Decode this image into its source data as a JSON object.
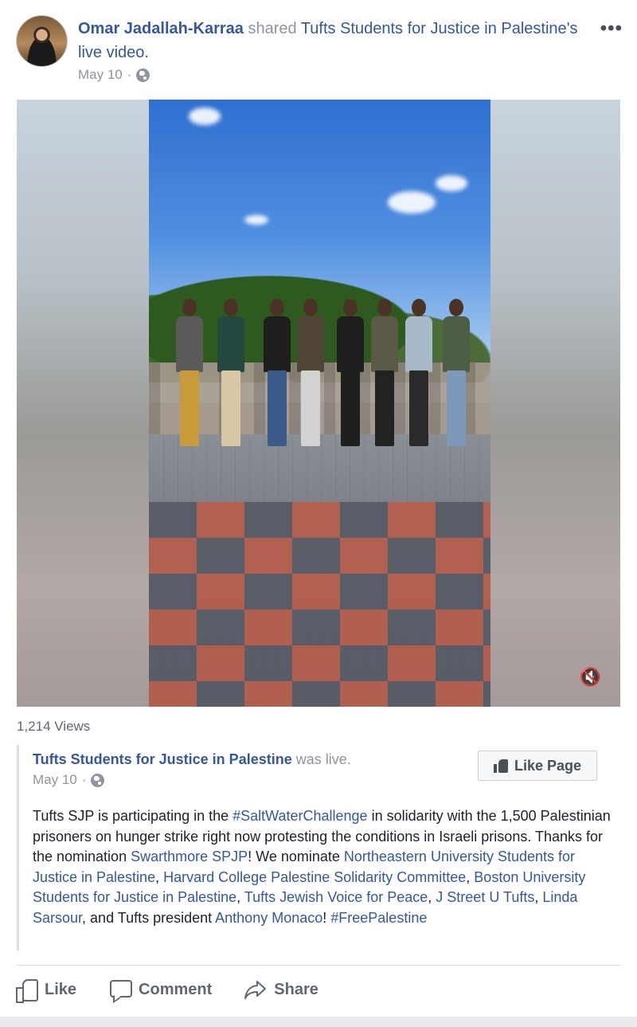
{
  "header": {
    "author": "Omar Jadallah-Karraa",
    "action_word": "shared",
    "shared_page": "Tufts Students for Justice in Palestine",
    "shared_suffix": "'s",
    "shared_object": "live video.",
    "date": "May 10",
    "separator": "·"
  },
  "more_label": "•••",
  "video": {
    "mute_icon": "🔇",
    "views": "1,214 Views"
  },
  "shared_post": {
    "page_name": "Tufts Students for Justice in Palestine",
    "status": "was live.",
    "date": "May 10",
    "separator": "·",
    "like_page_label": "Like Page",
    "body": {
      "t1": "Tufts SJP is participating in the ",
      "hashtag1": "#SaltWaterChallenge",
      "t2": " in solidarity with the 1,500 Palestinian prisoners on hunger strike right now protesting the conditions in Israeli prisons. Thanks for the nomination ",
      "link1": "Swarthmore SPJP",
      "t3": "! We nominate ",
      "link2": "Northeastern University Students for Justice in Palestine",
      "t4": ", ",
      "link3": "Harvard College Palestine Solidarity Committee",
      "t5": ", ",
      "link4": "Boston University Students for Justice in Palestine",
      "t6": ", ",
      "link5": "Tufts Jewish Voice for Peace",
      "t7": ", ",
      "link6": "J Street U Tufts",
      "t8": ", ",
      "link7": "Linda Sarsour",
      "t9": ", and Tufts president ",
      "link8": "Anthony Monaco",
      "t10": "! ",
      "hashtag2": "#FreePalestine"
    }
  },
  "actions": {
    "like": "Like",
    "comment": "Comment",
    "share": "Share"
  },
  "colors": {
    "link": "#365899",
    "meta": "#90949c",
    "text": "#1d2129"
  }
}
